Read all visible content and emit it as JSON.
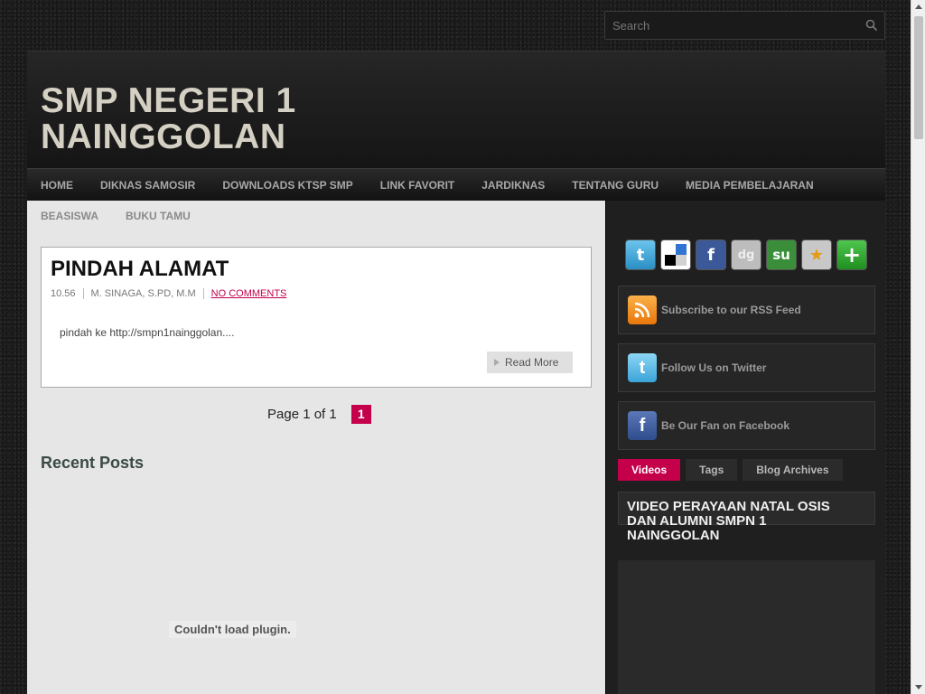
{
  "search": {
    "placeholder": "Search"
  },
  "site": {
    "title": "SMP NEGERI 1 NAINGGOLAN"
  },
  "nav": {
    "items": [
      "HOME",
      "DIKNAS SAMOSIR",
      "DOWNLOADS KTSP SMP",
      "LINK FAVORIT",
      "JARDIKNAS",
      "TENTANG GURU",
      "MEDIA PEMBELAJARAN"
    ],
    "items2": [
      "BEASISWA",
      "BUKU TAMU"
    ]
  },
  "post": {
    "title": "PINDAH ALAMAT",
    "time": "10.56",
    "author": "M. SINAGA, S.PD, M.M",
    "comments": "NO COMMENTS",
    "excerpt": "pindah ke http://smpn1nainggolan....",
    "read_more": "Read More"
  },
  "pager": {
    "info": "Page 1 of 1",
    "current": "1"
  },
  "recent": {
    "title": "Recent Posts",
    "plugin_message": "Couldn't load plugin."
  },
  "sidebar": {
    "social_icons": [
      "twitter-icon",
      "delicious-icon",
      "facebook-icon",
      "digg-icon",
      "stumbleupon-icon",
      "favorites-icon",
      "add-icon"
    ],
    "rss": "Subscribe to our RSS Feed",
    "twitter": "Follow Us on Twitter",
    "facebook": "Be Our Fan on Facebook",
    "tabs": [
      "Videos",
      "Tags",
      "Blog Archives"
    ],
    "video_title": "VIDEO PERAYAAN NATAL OSIS DAN ALUMNI SMPN 1 NAINGGOLAN"
  },
  "colors": {
    "accent": "#c4004b",
    "twitter": "#3fa4d8",
    "facebook": "#3b5998",
    "rss": "#f7931e"
  }
}
